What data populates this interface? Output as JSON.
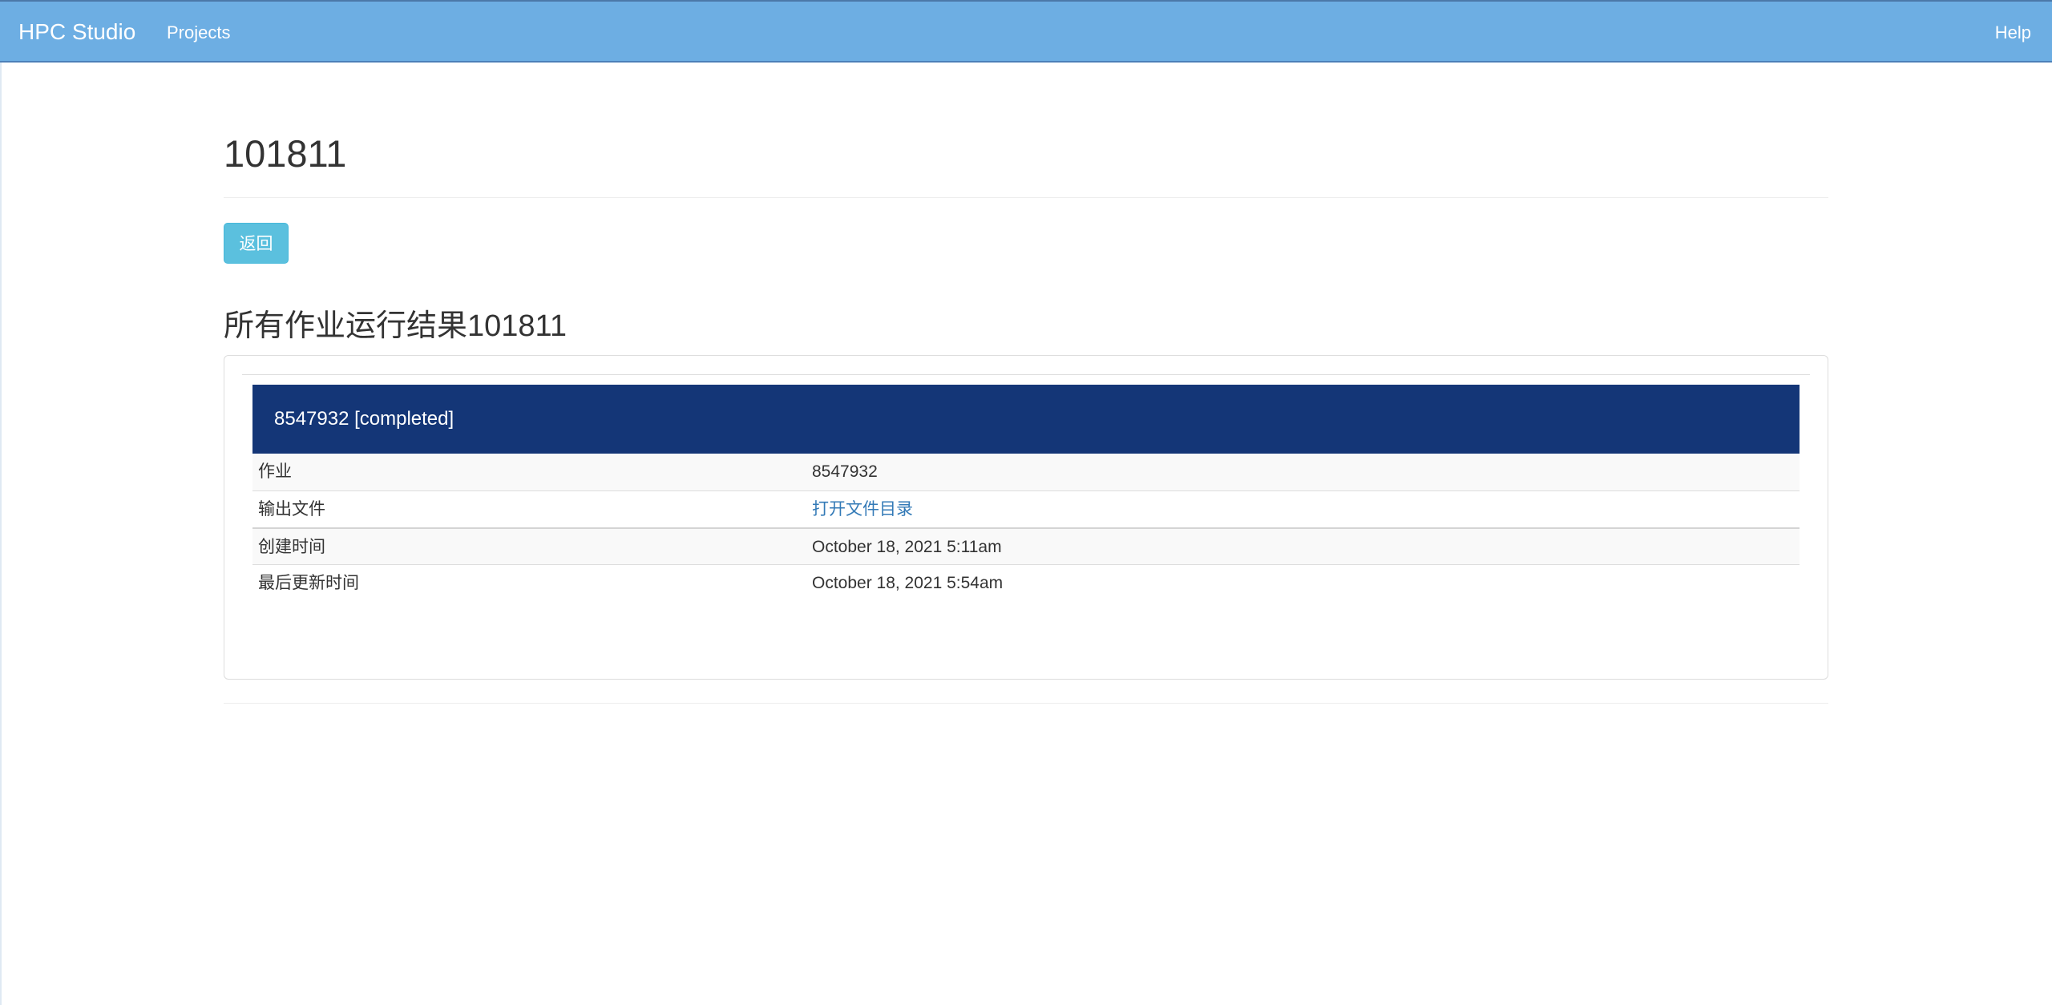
{
  "navbar": {
    "brand": "HPC Studio",
    "projects_label": "Projects",
    "help_label": "Help",
    "background_color": "#6daee3"
  },
  "page": {
    "title": "101811",
    "back_button_label": "返回",
    "section_title": "所有作业运行结果101811"
  },
  "job": {
    "header": "8547932 [completed]",
    "header_color": "#143677",
    "rows": [
      {
        "label": "作业",
        "value": "8547932"
      },
      {
        "label": "输出文件",
        "value": "打开文件目录"
      },
      {
        "label": "创建时间",
        "value": "October 18, 2021 5:11am"
      },
      {
        "label": "最后更新时间",
        "value": "October 18, 2021 5:54am"
      }
    ]
  }
}
